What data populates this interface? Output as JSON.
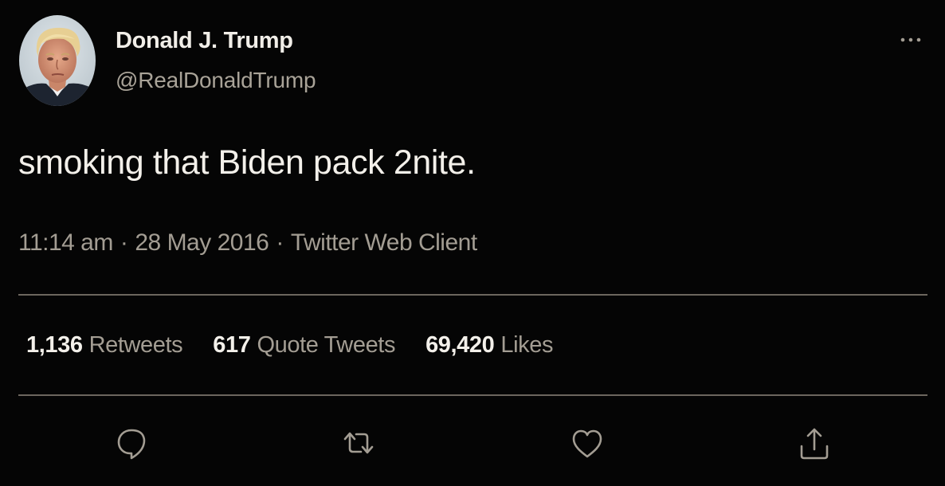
{
  "author": {
    "name": "Donald J. Trump",
    "handle": "@RealDonaldTrump"
  },
  "tweet": {
    "text": "smoking that Biden pack 2nite.",
    "time": "11:14 am",
    "date": "28 May 2016",
    "client": "Twitter Web Client",
    "separator": "·"
  },
  "stats": {
    "retweets_count": "1,136",
    "retweets_label": "Retweets",
    "quotes_count": "617",
    "quotes_label": "Quote Tweets",
    "likes_count": "69,420",
    "likes_label": "Likes"
  },
  "icons": {
    "more": "more-horizontal-icon",
    "reply": "reply-icon",
    "retweet": "retweet-icon",
    "like": "heart-icon",
    "share": "share-icon"
  },
  "colors": {
    "background": "#050505",
    "primary_text": "#f3f0ea",
    "secondary_text": "#a39d93",
    "divider": "#6c665e"
  }
}
